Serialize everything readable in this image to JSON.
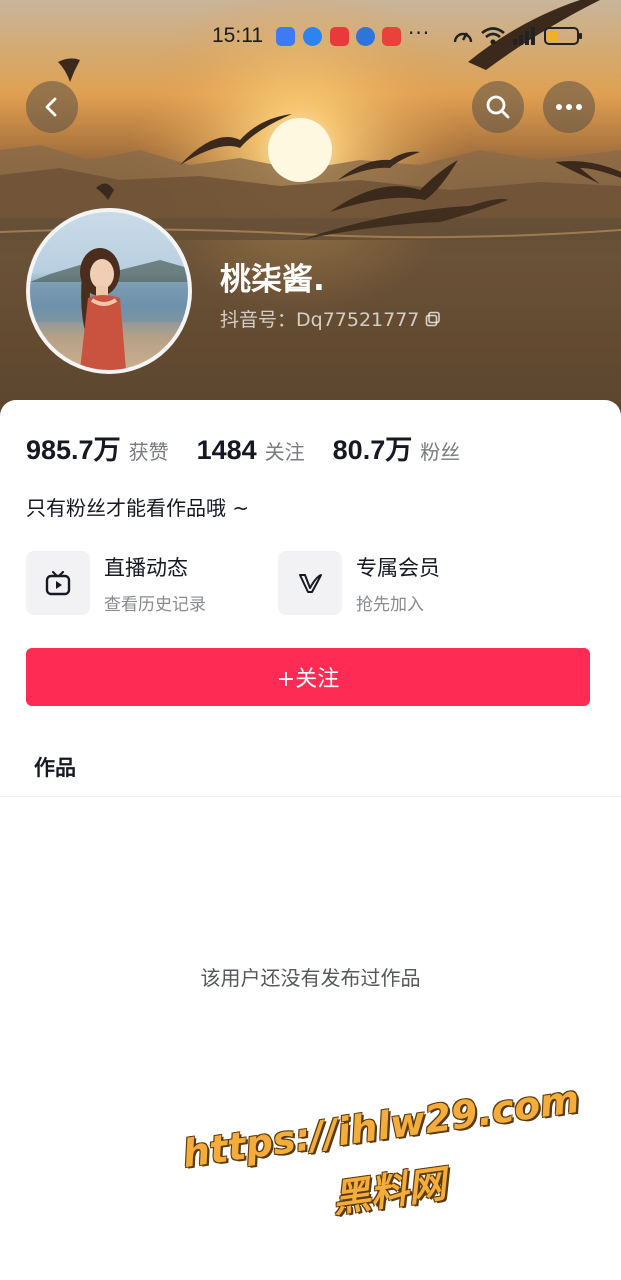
{
  "status_bar": {
    "time": "15:11",
    "more_dots": "···",
    "notification_icons": [
      "broadcast-icon",
      "message-icon",
      "app-icon",
      "browser-icon",
      "app-badge-icon"
    ]
  },
  "header": {
    "back_icon": "chevron-left-icon",
    "search_icon": "search-icon",
    "more_icon": "more-horizontal-icon"
  },
  "profile": {
    "name": "桃柒酱.",
    "douyin_id": "抖音号：Dq77521777"
  },
  "stats": [
    {
      "value": "985.7万",
      "label": "获赞"
    },
    {
      "value": "1484",
      "label": "关注"
    },
    {
      "value": "80.7万",
      "label": "粉丝"
    }
  ],
  "bio": "只有粉丝才能看作品哦 ~",
  "cards": [
    {
      "title": "直播动态",
      "subtitle": "查看历史记录",
      "icon": "tv-play-icon"
    },
    {
      "title": "专属会员",
      "subtitle": "抢先加入",
      "icon": "vip-v-icon"
    }
  ],
  "follow_button": "+关注",
  "tab_works": "作品",
  "empty_text": "该用户还没有发布过作品",
  "watermark": {
    "line1": "https://ihlw29.com",
    "line2": "黑料网"
  },
  "colors": {
    "accent": "#fe2c55",
    "text_primary": "#161823",
    "text_secondary": "#7a7b80"
  }
}
